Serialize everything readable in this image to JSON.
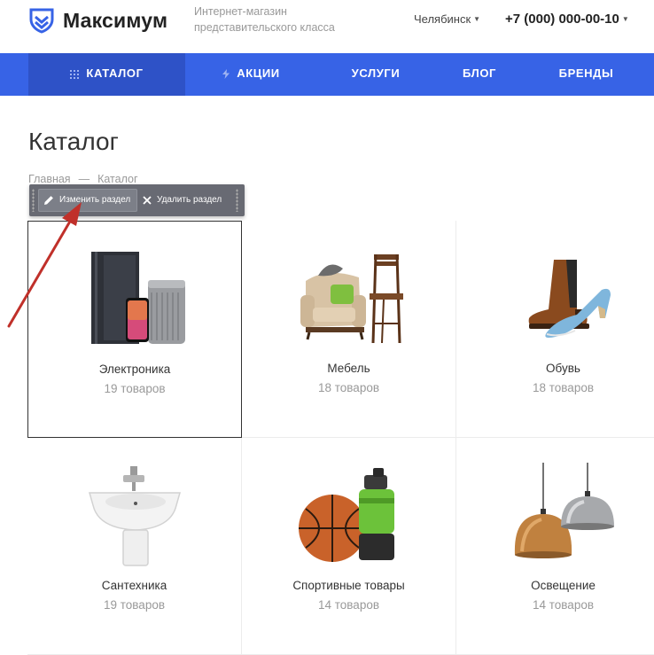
{
  "header": {
    "logo_text": "Максимум",
    "tagline": "Интернет-магазин представительского класса",
    "city": "Челябинск",
    "phone": "+7 (000) 000-00-10"
  },
  "nav": {
    "items": [
      {
        "label": "КАТАЛОГ",
        "icon": "grid-icon"
      },
      {
        "label": "АКЦИИ",
        "icon": "lightning-icon"
      },
      {
        "label": "УСЛУГИ"
      },
      {
        "label": "БЛОГ"
      },
      {
        "label": "БРЕНДЫ"
      }
    ]
  },
  "page": {
    "title": "Каталог",
    "breadcrumb": {
      "home": "Главная",
      "separator": "—",
      "current": "Каталог"
    }
  },
  "admin_toolbar": {
    "edit_label": "Изменить раздел",
    "delete_label": "Удалить раздел"
  },
  "categories": [
    {
      "name": "Электроника",
      "count": "19 товаров",
      "icon": "electronics-image"
    },
    {
      "name": "Мебель",
      "count": "18 товаров",
      "icon": "furniture-image"
    },
    {
      "name": "Обувь",
      "count": "18 товаров",
      "icon": "shoes-image"
    },
    {
      "name": "Сантехника",
      "count": "19 товаров",
      "icon": "plumbing-image"
    },
    {
      "name": "Спортивные товары",
      "count": "14 товаров",
      "icon": "sports-image"
    },
    {
      "name": "Освещение",
      "count": "14 товаров",
      "icon": "lighting-image"
    }
  ],
  "colors": {
    "nav_bg": "#3763e6",
    "nav_active_bg": "#2e52c7",
    "annotation_arrow": "#c0302a"
  }
}
